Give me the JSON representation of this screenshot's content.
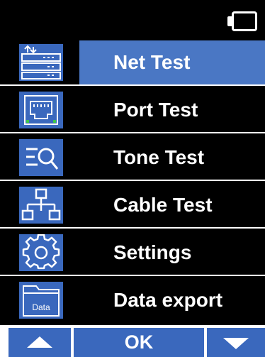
{
  "status": {
    "battery_icon": "battery-icon"
  },
  "menu": {
    "items": [
      {
        "label": "Net Test",
        "icon": "network-rack-icon",
        "selected": true
      },
      {
        "label": "Port Test",
        "icon": "ethernet-port-icon",
        "selected": false
      },
      {
        "label": "Tone Test",
        "icon": "search-list-icon",
        "selected": false
      },
      {
        "label": "Cable Test",
        "icon": "network-topology-icon",
        "selected": false
      },
      {
        "label": "Settings",
        "icon": "gear-icon",
        "selected": false
      },
      {
        "label": "Data export",
        "icon": "data-folder-icon",
        "selected": false,
        "icon_text": "Data"
      }
    ]
  },
  "footer": {
    "up_icon": "arrow-up-icon",
    "ok_label": "OK",
    "down_icon": "arrow-down-icon"
  },
  "colors": {
    "accent": "#3a68bd",
    "selected": "#4a77c4",
    "background": "#000000",
    "text": "#ffffff"
  }
}
